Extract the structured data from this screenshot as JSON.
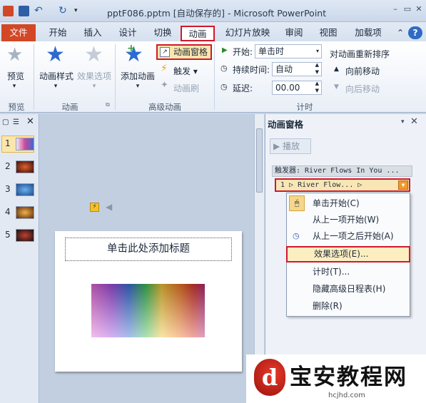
{
  "window": {
    "title": "pptF086.pptm [自动保存的] - Microsoft PowerPoint",
    "controls": [
      "?",
      "▭",
      "✕"
    ]
  },
  "tabs": [
    {
      "label": "文件"
    },
    {
      "label": "开始"
    },
    {
      "label": "插入"
    },
    {
      "label": "设计"
    },
    {
      "label": "切换"
    },
    {
      "label": "动画"
    },
    {
      "label": "幻灯片放映"
    },
    {
      "label": "审阅"
    },
    {
      "label": "视图"
    },
    {
      "label": "加载项"
    }
  ],
  "ribbon": {
    "preview": {
      "button": "预览",
      "group": "预览"
    },
    "animation": {
      "style": "动画样式",
      "effect_options": "效果选项",
      "group": "动画"
    },
    "advanced": {
      "add_animation": "添加动画",
      "pane": "动画窗格",
      "trigger": "触发",
      "painter": "动画刷",
      "group": "高级动画"
    },
    "timing": {
      "start_label": "开始:",
      "start_value": "单击时",
      "duration_label": "持续时间:",
      "duration_value": "自动",
      "delay_label": "延迟:",
      "delay_value": "00.00",
      "reorder_title": "对动画重新排序",
      "move_earlier": "向前移动",
      "move_later": "向后移动",
      "group": "计时"
    }
  },
  "thumbnails": [
    {
      "num": "1",
      "color": "#f0d8ea"
    },
    {
      "num": "2",
      "color": "#5a1a14"
    },
    {
      "num": "3",
      "color": "#3a6aa8"
    },
    {
      "num": "4",
      "color": "#b0601c"
    },
    {
      "num": "5",
      "color": "#1a1a1a"
    }
  ],
  "slide": {
    "title_placeholder": "单击此处添加标题"
  },
  "anim_pane": {
    "title": "动画窗格",
    "play": "播放",
    "trigger_row": "触发器: River Flows In You ...",
    "item_row": "1 ▷  River Flow...  ▷",
    "menu": [
      "单击开始(C)",
      "从上一项开始(W)",
      "从上一项之后开始(A)",
      "效果选项(E)...",
      "计时(T)...",
      "隐藏高级日程表(H)",
      "删除(R)"
    ]
  },
  "watermark": {
    "text": "宝安教程网",
    "url": "hcjhd.com"
  },
  "colors": {
    "highlight_red": "#d0182c",
    "file_tab": "#d24726",
    "selected_item": "#f9e6b4"
  }
}
